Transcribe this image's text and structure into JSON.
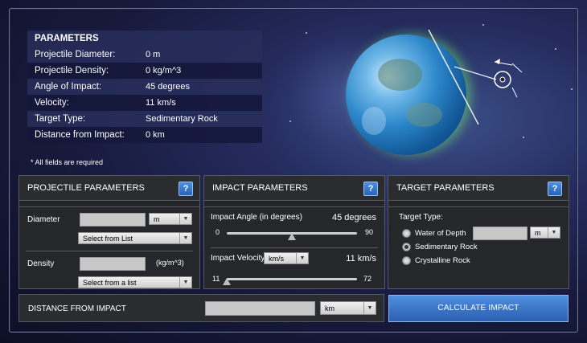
{
  "summary": {
    "title": "PARAMETERS",
    "rows": [
      {
        "label": "Projectile Diameter:",
        "value": "0 m"
      },
      {
        "label": "Projectile Density:",
        "value": "0 kg/m^3"
      },
      {
        "label": "Angle of Impact:",
        "value": "45 degrees"
      },
      {
        "label": "Velocity:",
        "value": "11 km/s"
      },
      {
        "label": "Target Type:",
        "value": "Sedimentary Rock"
      },
      {
        "label": "Distance from Impact:",
        "value": "0 km"
      }
    ],
    "required_note": "* All fields are required"
  },
  "projectile": {
    "title": "PROJECTILE PARAMETERS",
    "help": "?",
    "diameter_label": "Diameter",
    "diameter_value": "",
    "diameter_unit": "m",
    "diameter_list": "Select from List",
    "density_label": "Density",
    "density_value": "",
    "density_unit": "(kg/m^3)",
    "density_list": "Select from a list"
  },
  "impact": {
    "title": "IMPACT PARAMETERS",
    "help": "?",
    "angle_label": "Impact Angle (in degrees)",
    "angle_value": "45 degrees",
    "angle_min": "0",
    "angle_max": "90",
    "angle_level": 0.5,
    "velocity_label": "Impact Velocity",
    "velocity_unit": "km/s",
    "velocity_value": "11 km/s",
    "velocity_min": "11",
    "velocity_max": "72",
    "velocity_level": 0.0
  },
  "target": {
    "title": "TARGET PARAMETERS",
    "help": "?",
    "type_label": "Target Type:",
    "options": [
      {
        "label": "Water of Depth",
        "selected": false
      },
      {
        "label": "Sedimentary Rock",
        "selected": true
      },
      {
        "label": "Crystalline Rock",
        "selected": false
      }
    ],
    "depth_value": "",
    "depth_unit": "m"
  },
  "distance": {
    "label": "DISTANCE FROM IMPACT",
    "value": "",
    "unit": "km"
  },
  "calculate_label": "CALCULATE IMPACT"
}
